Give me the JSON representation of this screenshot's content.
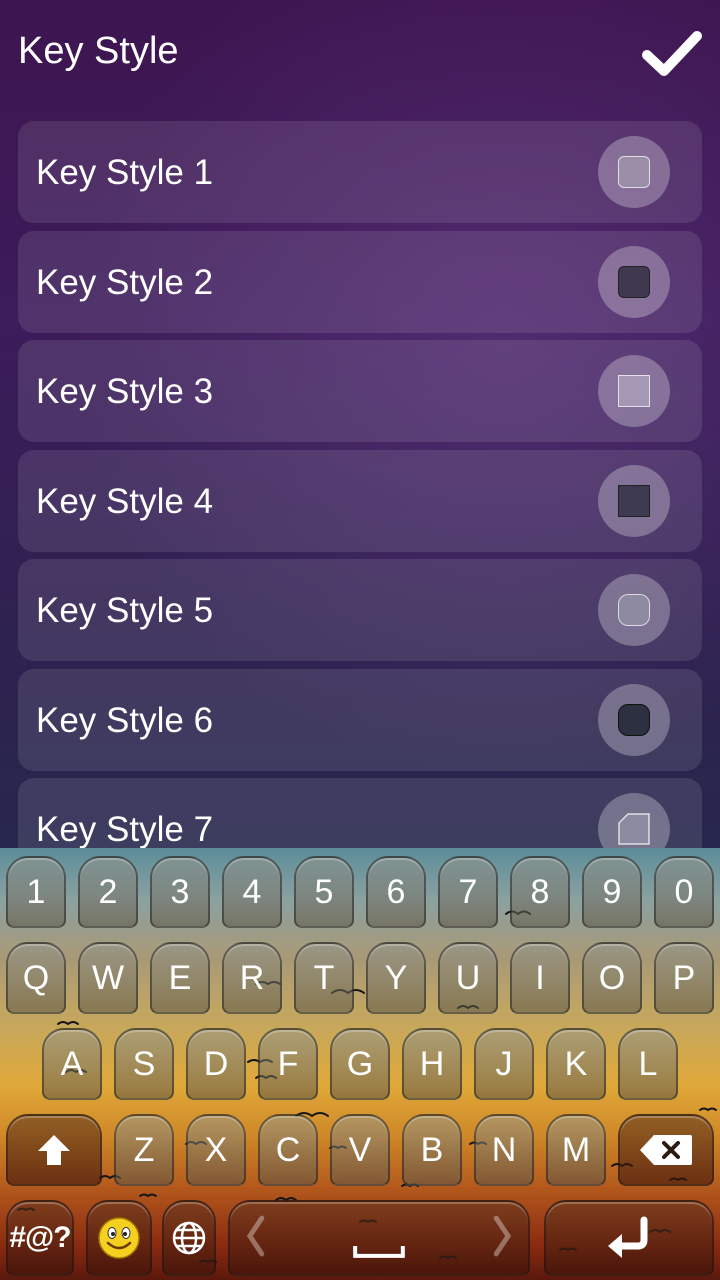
{
  "header": {
    "title": "Key Style"
  },
  "icons": {
    "confirm": "checkmark-icon",
    "shift": "shift-arrow-icon",
    "backspace": "backspace-icon",
    "emoji": "smiley-icon",
    "globe": "globe-icon",
    "enter": "return-arrow-icon",
    "space": "space-bar-icon"
  },
  "styles": [
    {
      "label": "Key Style 1"
    },
    {
      "label": "Key Style 2"
    },
    {
      "label": "Key Style 3"
    },
    {
      "label": "Key Style 4"
    },
    {
      "label": "Key Style 5"
    },
    {
      "label": "Key Style 6"
    },
    {
      "label": "Key Style 7"
    }
  ],
  "keyboard": {
    "row1": [
      "1",
      "2",
      "3",
      "4",
      "5",
      "6",
      "7",
      "8",
      "9",
      "0"
    ],
    "row2": [
      "Q",
      "W",
      "E",
      "R",
      "T",
      "Y",
      "U",
      "I",
      "O",
      "P"
    ],
    "row3": [
      "A",
      "S",
      "D",
      "F",
      "G",
      "H",
      "J",
      "K",
      "L"
    ],
    "row4": [
      "Z",
      "X",
      "C",
      "V",
      "B",
      "N",
      "M"
    ],
    "symbols_label": "#@?"
  }
}
